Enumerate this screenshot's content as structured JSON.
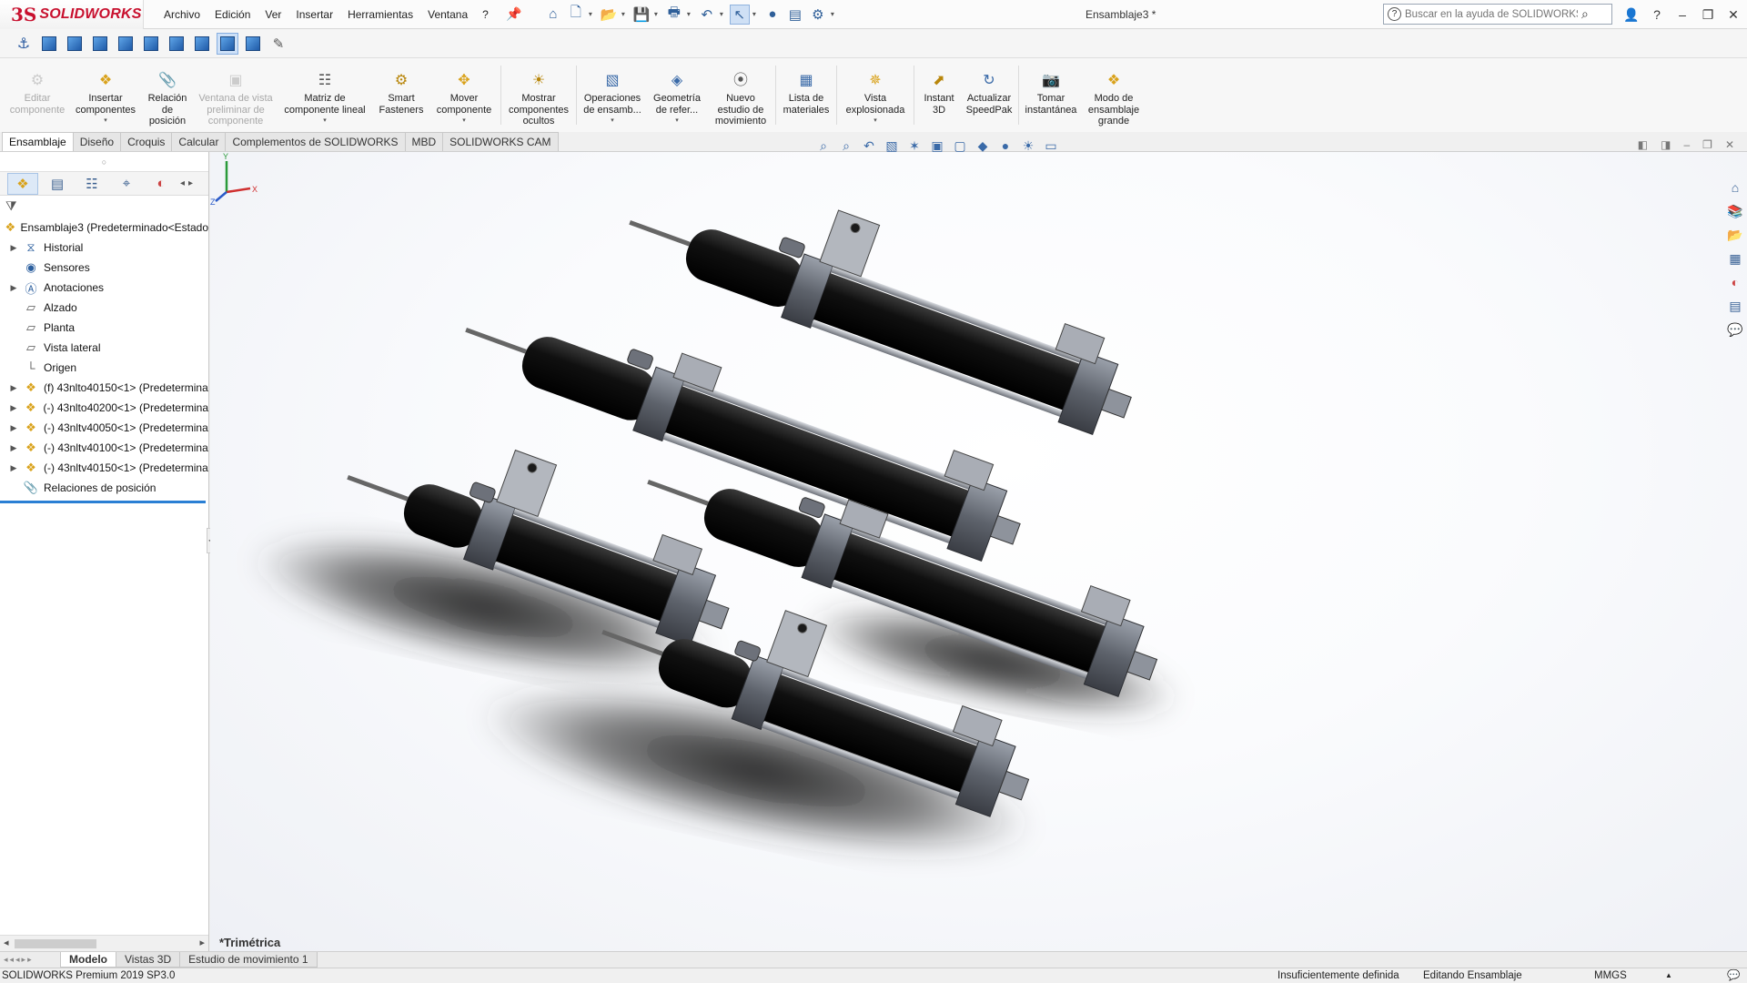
{
  "app": {
    "logo_prefix": "3S",
    "logo_name": "SOLIDWORKS",
    "document_title": "Ensamblaje3 *"
  },
  "menu": [
    "Archivo",
    "Edición",
    "Ver",
    "Insertar",
    "Herramientas",
    "Ventana",
    "?"
  ],
  "search": {
    "placeholder": "Buscar en la ayuda de SOLIDWORKS"
  },
  "command_manager": {
    "items": [
      {
        "label": "Editar componente",
        "enabled": false
      },
      {
        "label": "Insertar componentes",
        "enabled": true
      },
      {
        "label": "Relación de posición",
        "enabled": true
      },
      {
        "label": "Ventana de vista preliminar de componente",
        "enabled": false
      },
      {
        "label": "Matriz de componente lineal",
        "enabled": true
      },
      {
        "label": "Smart Fasteners",
        "enabled": true
      },
      {
        "label": "Mover componente",
        "enabled": true
      },
      {
        "label": "Mostrar componentes ocultos",
        "enabled": true
      },
      {
        "label": "Operaciones de ensamb...",
        "enabled": true
      },
      {
        "label": "Geometría de refer...",
        "enabled": true
      },
      {
        "label": "Nuevo estudio de movimiento",
        "enabled": true
      },
      {
        "label": "Lista de materiales",
        "enabled": true
      },
      {
        "label": "Vista explosionada",
        "enabled": true
      },
      {
        "label": "Instant 3D",
        "enabled": true
      },
      {
        "label": "Actualizar SpeedPak",
        "enabled": true
      },
      {
        "label": "Tomar instantánea",
        "enabled": true
      },
      {
        "label": "Modo de ensamblaje grande",
        "enabled": true
      }
    ]
  },
  "command_tabs": [
    "Ensamblaje",
    "Diseño",
    "Croquis",
    "Calcular",
    "Complementos de SOLIDWORKS",
    "MBD",
    "SOLIDWORKS CAM"
  ],
  "active_command_tab": "Ensamblaje",
  "feature_tree": {
    "root": "Ensamblaje3  (Predeterminado<Estado",
    "items": [
      {
        "label": "Historial",
        "icon": "history-icon",
        "expandable": true
      },
      {
        "label": "Sensores",
        "icon": "sensor-icon",
        "expandable": false
      },
      {
        "label": "Anotaciones",
        "icon": "annotations-icon",
        "expandable": true
      },
      {
        "label": "Alzado",
        "icon": "plane-icon",
        "expandable": false
      },
      {
        "label": "Planta",
        "icon": "plane-icon",
        "expandable": false
      },
      {
        "label": "Vista lateral",
        "icon": "plane-icon",
        "expandable": false
      },
      {
        "label": "Origen",
        "icon": "origin-icon",
        "expandable": false
      },
      {
        "label": "(f) 43nlto40150<1> (Predetermina",
        "icon": "part-icon",
        "expandable": true
      },
      {
        "label": "(-) 43nlto40200<1> (Predetermina",
        "icon": "part-icon",
        "expandable": true
      },
      {
        "label": "(-) 43nltv40050<1> (Predetermina",
        "icon": "part-icon",
        "expandable": true
      },
      {
        "label": "(-) 43nltv40100<1> (Predetermina",
        "icon": "part-icon",
        "expandable": true
      },
      {
        "label": "(-) 43nltv40150<1> (Predetermina",
        "icon": "part-icon",
        "expandable": true
      },
      {
        "label": "Relaciones de posición",
        "icon": "mates-icon",
        "expandable": false
      }
    ]
  },
  "viewport": {
    "view_name": "*Trimétrica",
    "triad": {
      "x": "X",
      "y": "Y",
      "z": "Z"
    }
  },
  "model_tabs": [
    "Modelo",
    "Vistas 3D",
    "Estudio de movimiento 1"
  ],
  "active_model_tab": "Modelo",
  "status": {
    "product": "SOLIDWORKS Premium 2019 SP3.0",
    "definition": "Insuficientemente definida",
    "mode": "Editando Ensamblaje",
    "units": "MMGS"
  }
}
